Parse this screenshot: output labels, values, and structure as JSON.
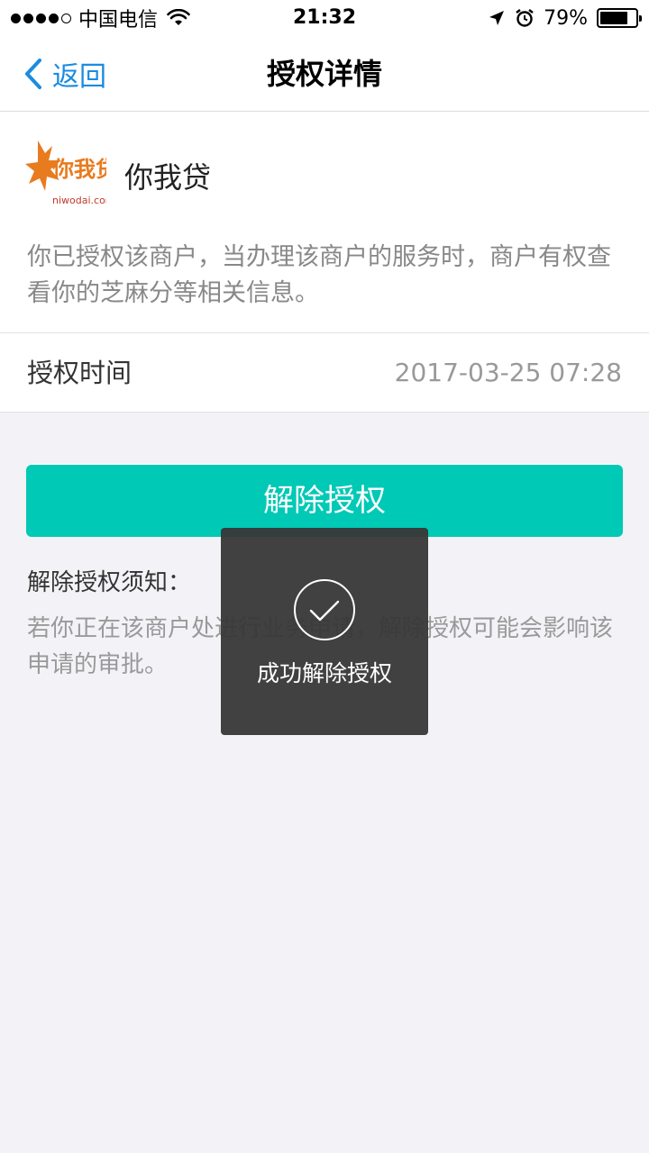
{
  "status_bar": {
    "carrier": "中国电信",
    "time": "21:32",
    "battery_text": "79%",
    "battery_level": 0.79
  },
  "nav": {
    "back_label": "返回",
    "title": "授权详情"
  },
  "merchant": {
    "logo_text": "你我贷",
    "logo_sub": "niwodai.com",
    "name": "你我贷",
    "description": "你已授权该商户，当办理该商户的服务时，商户有权查看你的芝麻分等相关信息。"
  },
  "auth_time": {
    "label": "授权时间",
    "value": "2017-03-25 07:28"
  },
  "revoke_button": "解除授权",
  "notice": {
    "title": "解除授权须知：",
    "text": "若你正在该商户处进行业务申请，解除授权可能会影响该申请的审批。"
  },
  "toast": {
    "message": "成功解除授权"
  },
  "colors": {
    "accent": "#00c9b5",
    "link": "#1a8ce0",
    "logo_orange": "#e87b1e"
  },
  "icons": {
    "back": "chevron-left-icon",
    "wifi": "wifi-icon",
    "location": "location-arrow-icon",
    "alarm": "alarm-icon",
    "battery": "battery-icon",
    "toast": "checkmark-circle-icon"
  }
}
